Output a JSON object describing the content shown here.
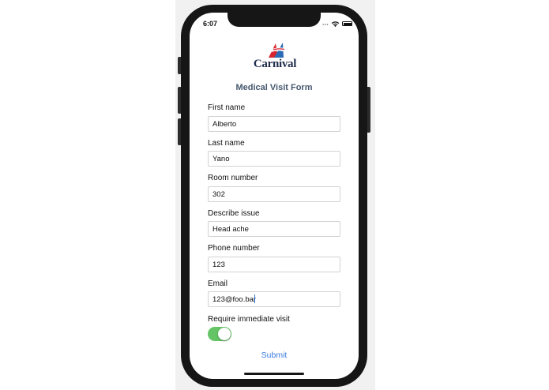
{
  "status_bar": {
    "time": "6:07"
  },
  "brand": {
    "name": "Carnival",
    "colors": {
      "navy": "#1f2c4c",
      "red": "#d6252f",
      "blue": "#2a6bb5"
    }
  },
  "form": {
    "title": "Medical Visit Form",
    "fields": [
      {
        "label": "First name",
        "value": "Alberto"
      },
      {
        "label": "Last name",
        "value": "Yano"
      },
      {
        "label": "Room number",
        "value": "302"
      },
      {
        "label": "Describe issue",
        "value": "Head ache"
      },
      {
        "label": "Phone number",
        "value": "123"
      },
      {
        "label": "Email",
        "value": "123@foo.bar"
      }
    ],
    "immediate_visit": {
      "label": "Require immediate visit",
      "on": true,
      "color": "#65c466"
    },
    "submit_label": "Submit"
  }
}
